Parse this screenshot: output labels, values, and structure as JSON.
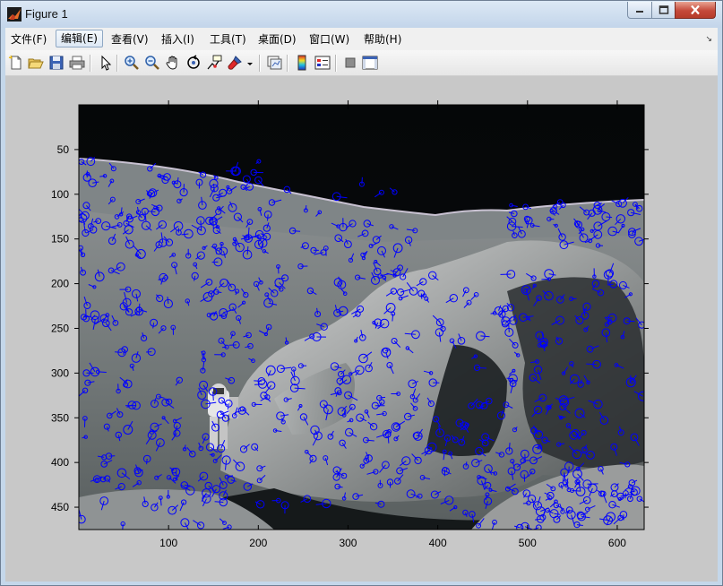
{
  "window": {
    "title": "Figure 1"
  },
  "menu": {
    "items": [
      {
        "label": "文件(F)"
      },
      {
        "label": "编辑(E)"
      },
      {
        "label": "查看(V)"
      },
      {
        "label": "插入(I)"
      },
      {
        "label": "工具(T)"
      },
      {
        "label": "桌面(D)"
      },
      {
        "label": "窗口(W)"
      },
      {
        "label": "帮助(H)"
      }
    ],
    "active_index": 1
  },
  "toolbar": {
    "icons": [
      "new-figure-icon",
      "open-file-icon",
      "save-icon",
      "print-icon",
      "edit-plot-arrow-icon",
      "zoom-in-icon",
      "zoom-out-icon",
      "pan-hand-icon",
      "rotate-3d-icon",
      "data-cursor-icon",
      "brush-icon",
      "brush-dropdown-icon",
      "link-plot-icon",
      "insert-colorbar-icon",
      "insert-legend-icon",
      "hide-plot-tools-icon",
      "show-plot-tools-icon"
    ]
  },
  "axes": {
    "x_ticks": [
      "100",
      "200",
      "300",
      "400",
      "500",
      "600"
    ],
    "y_ticks": [
      "50",
      "100",
      "150",
      "200",
      "250",
      "300",
      "350",
      "400",
      "450"
    ],
    "x_range": [
      0,
      630
    ],
    "y_range": [
      0,
      475
    ]
  },
  "image": {
    "description_icon": "lunar-surface-image",
    "marker_color": "#0000ff"
  }
}
